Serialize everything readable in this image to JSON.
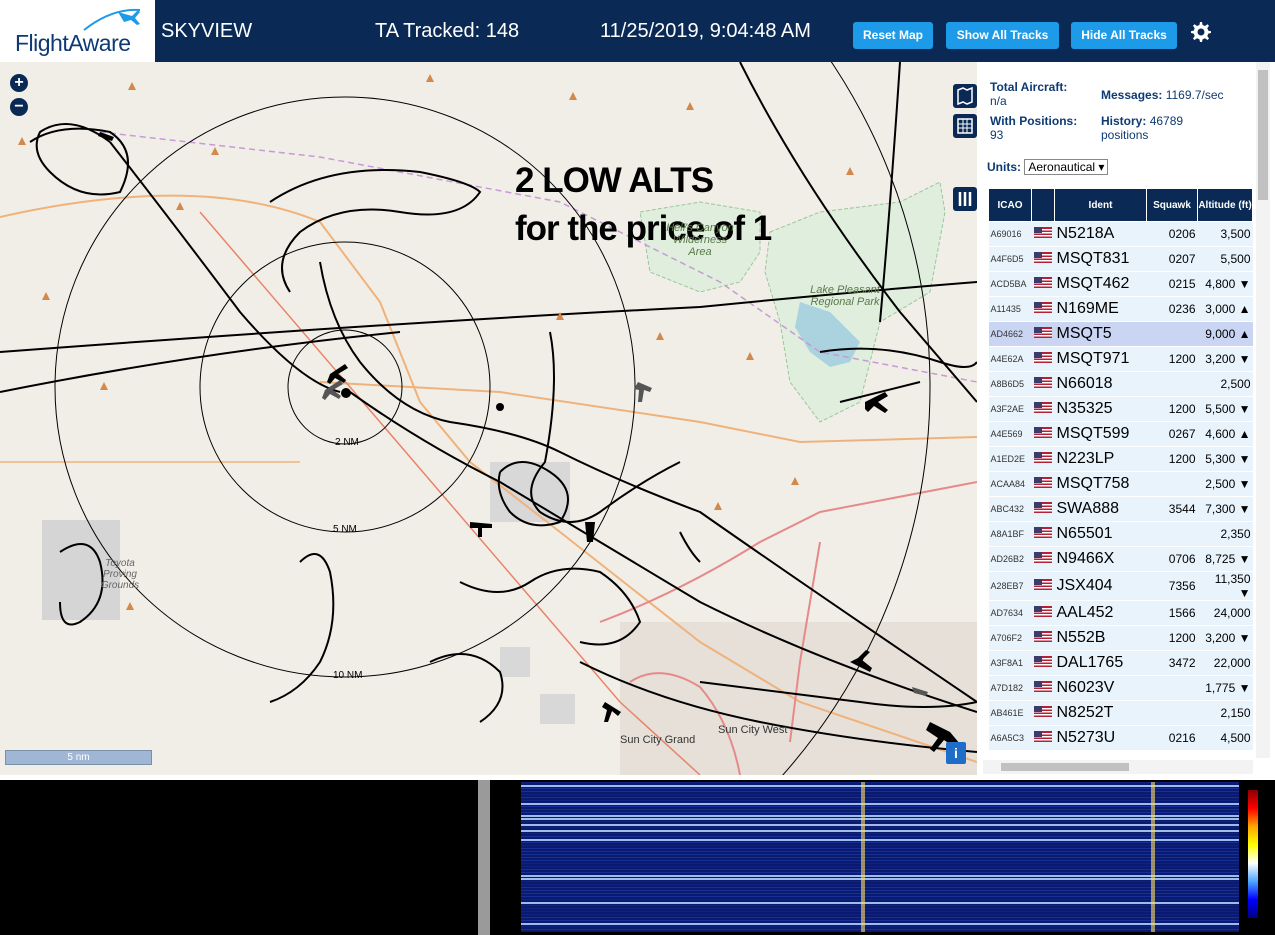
{
  "header": {
    "logo": "FlightAware",
    "app_name": "SKYVIEW",
    "tracked": "TA Tracked: 148",
    "datetime": "11/25/2019, 9:04:48 AM",
    "buttons": [
      "Reset Map",
      "Show All Tracks",
      "Hide All Tracks"
    ]
  },
  "map": {
    "annotation_line1": "2 LOW ALTS",
    "annotation_line2": "for the price of 1",
    "zoom_in": "+",
    "zoom_out": "−",
    "labels": {
      "wilderness": "Hell's Canyon Wilderness Area",
      "lake": "Lake Pleasant Regional Park",
      "toyota": "Toyota Proving Grounds",
      "sun_city_grand": "Sun City Grand",
      "sun_city_west": "Sun City West"
    },
    "rings": [
      "2 NM",
      "5 NM",
      "10 NM"
    ],
    "scale": "5 nm",
    "info": "i"
  },
  "panel": {
    "total_aircraft_label": "Total Aircraft:",
    "total_aircraft_value": "n/a",
    "with_positions_label": "With Positions:",
    "with_positions_value": "93",
    "messages_label": "Messages:",
    "messages_value": "1169.7/sec",
    "history_label": "History:",
    "history_value": "46789",
    "history_unit": "positions",
    "units_label": "Units:",
    "units_value": "Aeronautical",
    "columns": [
      "ICAO",
      "Ident",
      "Squawk",
      "Altitude (ft)"
    ],
    "rows": [
      {
        "icao": "A69016",
        "ident": "N5218A",
        "squawk": "0206",
        "alt": "3,500",
        "trend": ""
      },
      {
        "icao": "A4F6D5",
        "ident": "MSQT831",
        "squawk": "0207",
        "alt": "5,500",
        "trend": ""
      },
      {
        "icao": "ACD5BA",
        "ident": "MSQT462",
        "squawk": "0215",
        "alt": "4,800",
        "trend": "▼"
      },
      {
        "icao": "A11435",
        "ident": "N169ME",
        "squawk": "0236",
        "alt": "3,000",
        "trend": "▲"
      },
      {
        "icao": "AD4662",
        "ident": "MSQT5",
        "squawk": "",
        "alt": "9,000",
        "trend": "▲"
      },
      {
        "icao": "A4E62A",
        "ident": "MSQT971",
        "squawk": "1200",
        "alt": "3,200",
        "trend": "▼"
      },
      {
        "icao": "A8B6D5",
        "ident": "N66018",
        "squawk": "",
        "alt": "2,500",
        "trend": ""
      },
      {
        "icao": "A3F2AE",
        "ident": "N35325",
        "squawk": "1200",
        "alt": "5,500",
        "trend": "▼"
      },
      {
        "icao": "A4E569",
        "ident": "MSQT599",
        "squawk": "0267",
        "alt": "4,600",
        "trend": "▲"
      },
      {
        "icao": "A1ED2E",
        "ident": "N223LP",
        "squawk": "1200",
        "alt": "5,300",
        "trend": "▼"
      },
      {
        "icao": "ACAA84",
        "ident": "MSQT758",
        "squawk": "",
        "alt": "2,500",
        "trend": "▼"
      },
      {
        "icao": "ABC432",
        "ident": "SWA888",
        "squawk": "3544",
        "alt": "7,300",
        "trend": "▼"
      },
      {
        "icao": "A8A1BF",
        "ident": "N65501",
        "squawk": "",
        "alt": "2,350",
        "trend": ""
      },
      {
        "icao": "AD26B2",
        "ident": "N9466X",
        "squawk": "0706",
        "alt": "8,725",
        "trend": "▼"
      },
      {
        "icao": "A28EB7",
        "ident": "JSX404",
        "squawk": "7356",
        "alt": "11,350",
        "trend": "▼"
      },
      {
        "icao": "AD7634",
        "ident": "AAL452",
        "squawk": "1566",
        "alt": "24,000",
        "trend": ""
      },
      {
        "icao": "A706F2",
        "ident": "N552B",
        "squawk": "1200",
        "alt": "3,200",
        "trend": "▼"
      },
      {
        "icao": "A3F8A1",
        "ident": "DAL1765",
        "squawk": "3472",
        "alt": "22,000",
        "trend": ""
      },
      {
        "icao": "A7D182",
        "ident": "N6023V",
        "squawk": "",
        "alt": "1,775",
        "trend": "▼"
      },
      {
        "icao": "AB461E",
        "ident": "N8252T",
        "squawk": "",
        "alt": "2,150",
        "trend": ""
      },
      {
        "icao": "A6A5C3",
        "ident": "N5273U",
        "squawk": "0216",
        "alt": "4,500",
        "trend": ""
      }
    ]
  },
  "colors": {
    "header": "#0a2a55",
    "button": "#1e9be8",
    "row": "#e8f3fc",
    "selected_row": "#c9d5f3"
  }
}
